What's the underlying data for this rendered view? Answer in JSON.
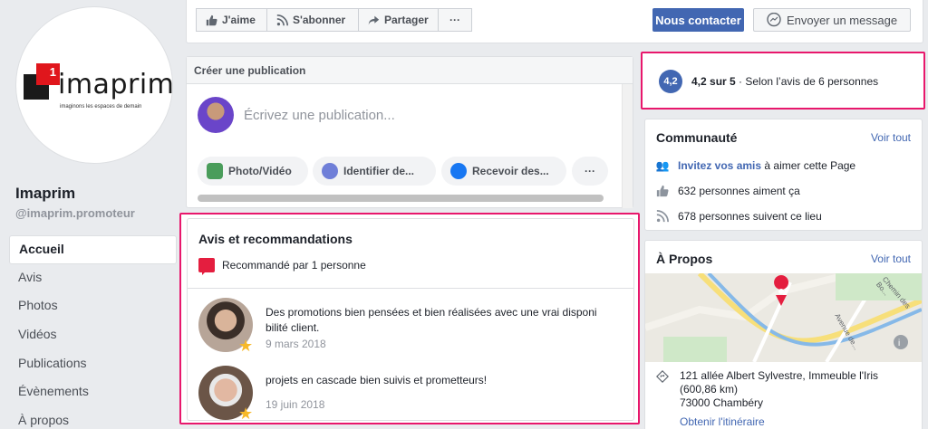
{
  "page": {
    "logo_word": "imaprim",
    "logo_badge": "1",
    "logo_tagline": "imaginons les espaces de demain",
    "name": "Imaprim",
    "handle": "@imaprim.promoteur"
  },
  "nav": [
    {
      "label": "Accueil",
      "active": true
    },
    {
      "label": "Avis"
    },
    {
      "label": "Photos"
    },
    {
      "label": "Vidéos"
    },
    {
      "label": "Publications"
    },
    {
      "label": "Évènements"
    },
    {
      "label": "À propos"
    }
  ],
  "actions": {
    "like": "J'aime",
    "subscribe": "S'abonner",
    "share": "Partager",
    "more": "···",
    "contact": "Nous contacter",
    "message": "Envoyer un message"
  },
  "create_post": {
    "title": "Créer une publication",
    "placeholder": "Écrivez une publication...",
    "buttons": [
      "Photo/Vidéo",
      "Identifier de...",
      "Recevoir des...",
      "···"
    ]
  },
  "reviews": {
    "title": "Avis et recommandations",
    "recommended": "Recommandé par 1 personne",
    "items": [
      {
        "text": "Des promotions bien pensées et bien réalisées avec une vrai disponi bilité client.",
        "date": "9 mars 2018"
      },
      {
        "text": "projets en cascade bien suivis et prometteurs!",
        "date": "19 juin 2018"
      }
    ]
  },
  "rating": {
    "badge": "4,2",
    "score": "4,2 sur 5",
    "detail": " · Selon l’avis de 6 personnes"
  },
  "community": {
    "title": "Communauté",
    "see_all": "Voir tout",
    "invite_link": "Invitez vos amis",
    "invite_rest": " à aimer cette Page",
    "likes": "632 personnes aiment ça",
    "follows": "678 personnes suivent ce lieu"
  },
  "about": {
    "title": "À Propos",
    "see_all": "Voir tout",
    "address_line1": "121 allée Albert Sylvestre, Immeuble l'Iris",
    "address_line2": "(600,86 km)",
    "address_line3": "73000 Chambéry",
    "directions": "Obtenir l'itinéraire",
    "map_label_1": "Chemin des Bo...",
    "map_label_2": "Avenue de..."
  },
  "colors": {
    "brand": "#4267b2",
    "highlight": "#e8176c",
    "logo_red": "#e0161c"
  }
}
